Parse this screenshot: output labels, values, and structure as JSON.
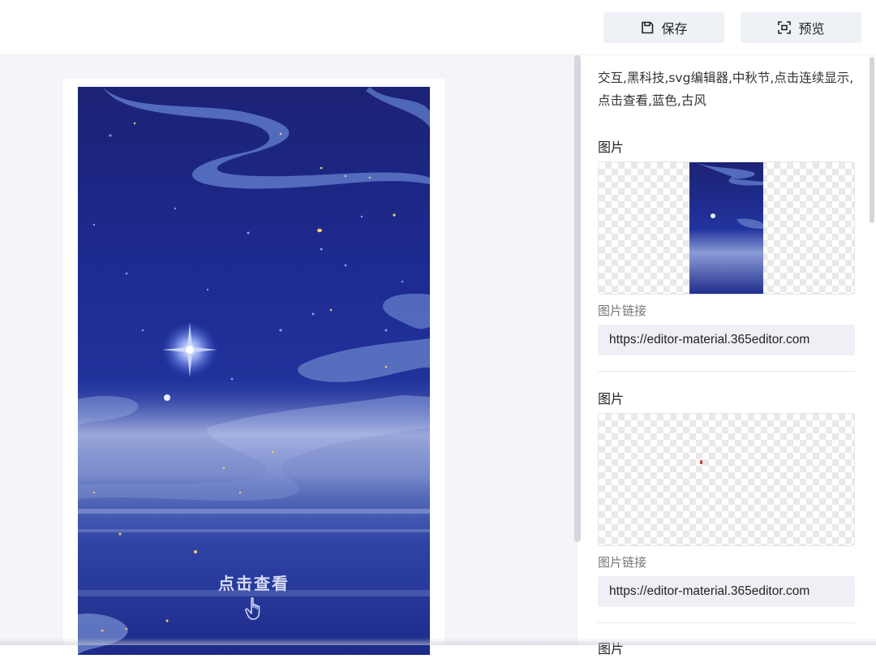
{
  "toolbar": {
    "save_label": "保存",
    "preview_label": "预览"
  },
  "canvas": {
    "cta_text": "点击查看"
  },
  "panel": {
    "tags": "交互,黑科技,svg编辑器,中秋节,点击连续显示,点击查看,蓝色,古风",
    "images": [
      {
        "label": "图片",
        "link_label": "图片链接",
        "url": "https://editor-material.365editor.com"
      },
      {
        "label": "图片",
        "link_label": "图片链接",
        "url": "https://editor-material.365editor.com"
      },
      {
        "label": "图片"
      }
    ]
  },
  "colors": {
    "accent_bg": "#eef1f6",
    "night_blue": "#1d2a8f",
    "canvas_bg": "#f4f5f9"
  }
}
